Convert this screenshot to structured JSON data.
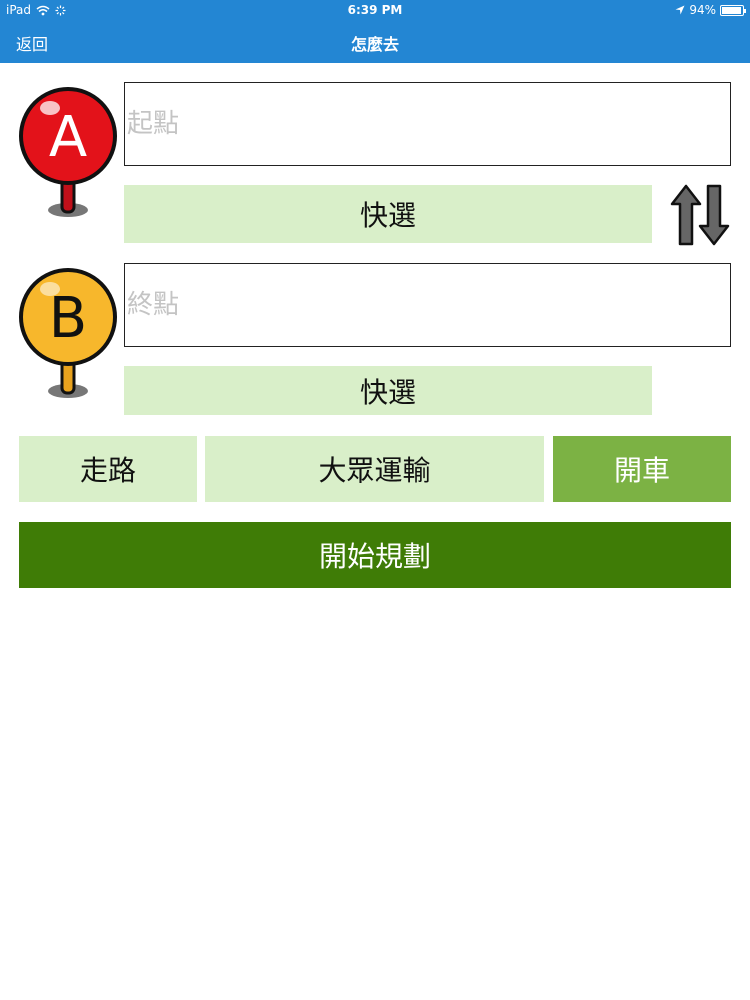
{
  "status_bar": {
    "device": "iPad",
    "time": "6:39 PM",
    "battery": "94%"
  },
  "nav": {
    "back_label": "返回",
    "title": "怎麼去"
  },
  "origin": {
    "pin_letter": "A",
    "pin_color": "#e3121a",
    "placeholder": "起點",
    "value": "",
    "quick_label": "快選"
  },
  "destination": {
    "pin_letter": "B",
    "pin_color": "#f7b72c",
    "placeholder": "終點",
    "value": "",
    "quick_label": "快選"
  },
  "modes": [
    {
      "label": "走路",
      "selected": false
    },
    {
      "label": "大眾運輸",
      "selected": false
    },
    {
      "label": "開車",
      "selected": true
    }
  ],
  "start_button": {
    "label": "開始規劃"
  },
  "colors": {
    "header": "#2386d3",
    "light_green": "#d9efc9",
    "selected_green": "#7cb244",
    "dark_green": "#3f7c06"
  }
}
